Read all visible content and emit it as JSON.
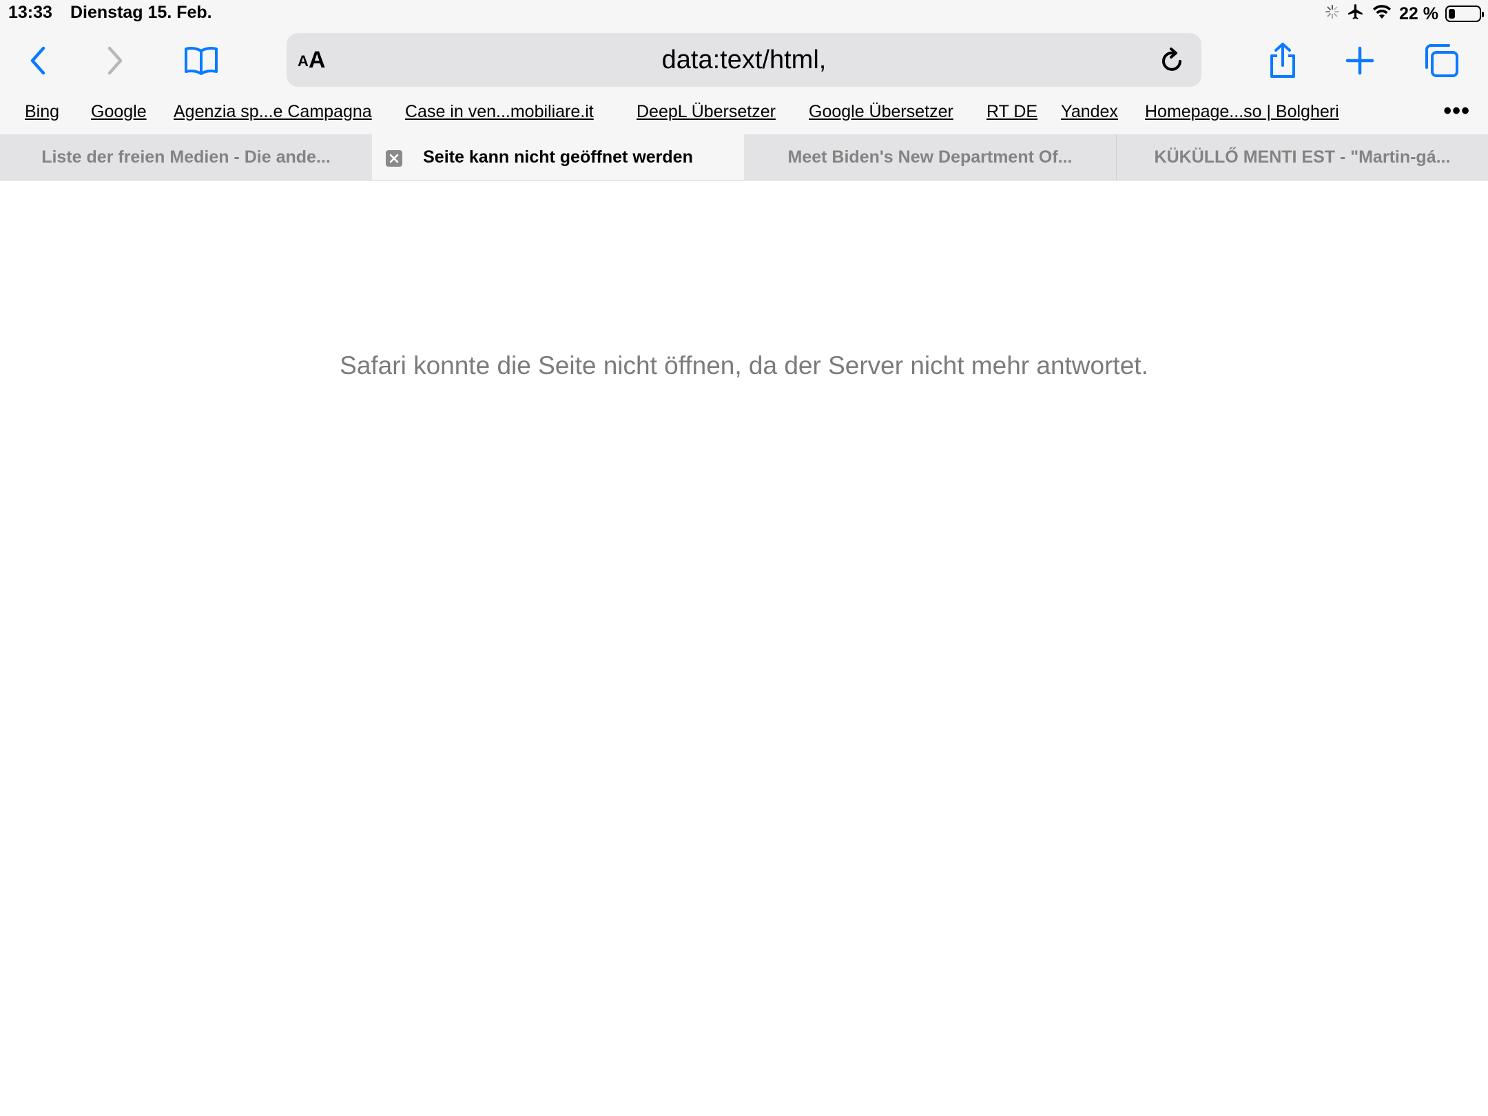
{
  "status_bar": {
    "time": "13:33",
    "date": "Dienstag 15. Feb.",
    "battery_percent": "22 %",
    "battery_level": 0.22,
    "icons": [
      "activity-spinner-icon",
      "airplane-icon",
      "wifi-icon",
      "battery-icon"
    ]
  },
  "toolbar": {
    "back_icon": "chevron-left-icon",
    "forward_icon": "chevron-right-icon",
    "bookmarks_icon": "book-icon",
    "aa_small": "A",
    "aa_large": "A",
    "url": "data:text/html,",
    "reload_icon": "reload-icon",
    "share_icon": "share-icon",
    "new_tab_icon": "plus-icon",
    "tabs_icon": "tabs-overview-icon",
    "accent_color": "#0a7aff"
  },
  "favorites": [
    {
      "label": "Bing"
    },
    {
      "label": "Google"
    },
    {
      "label": "Agenzia sp...e Campagna"
    },
    {
      "label": "Case in ven...mobiliare.it"
    },
    {
      "label": "DeepL Übersetzer"
    },
    {
      "label": "Google Übersetzer"
    },
    {
      "label": "RT DE"
    },
    {
      "label": "Yandex"
    },
    {
      "label": "Homepage...so | Bolgheri"
    }
  ],
  "favorites_more": "•••",
  "tabs": [
    {
      "title": "Liste der freien Medien - Die ande...",
      "active": false
    },
    {
      "title": "Seite kann nicht geöffnet werden",
      "active": true
    },
    {
      "title": "Meet Biden's New Department Of...",
      "active": false
    },
    {
      "title": "KÜKÜLLŐ MENTI EST - \"Martin-gá...",
      "active": false
    }
  ],
  "content": {
    "error_message": "Safari konnte die Seite nicht öffnen, da der Server nicht mehr antwortet."
  }
}
